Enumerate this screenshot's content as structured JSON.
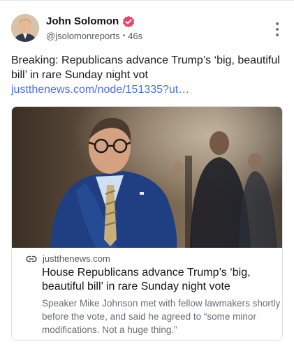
{
  "author": {
    "name": "John Solomon",
    "handle": "@jsolomonreports",
    "separator": "•",
    "time": "46s",
    "verified_color": "#e8456b"
  },
  "post": {
    "text": "Breaking: Republicans advance Trump’s ‘big, beautiful bill’ in rare Sunday night vot ",
    "link_text": "justthenews.com/node/151335?ut…",
    "link_color": "#4a6fe0"
  },
  "card": {
    "domain": "justthenews.com",
    "title": "House Republicans advance Trump’s ‘big, beautiful bill’ in rare Sunday night vote",
    "description": "Speaker Mike Johnson met with fellow lawmakers shortly before the vote, and said he agreed to “some minor modifications. Not a huge thing.”"
  },
  "icons": {
    "menu": "more-vertical-icon",
    "link": "link-icon",
    "verified": "verified-badge-icon"
  }
}
